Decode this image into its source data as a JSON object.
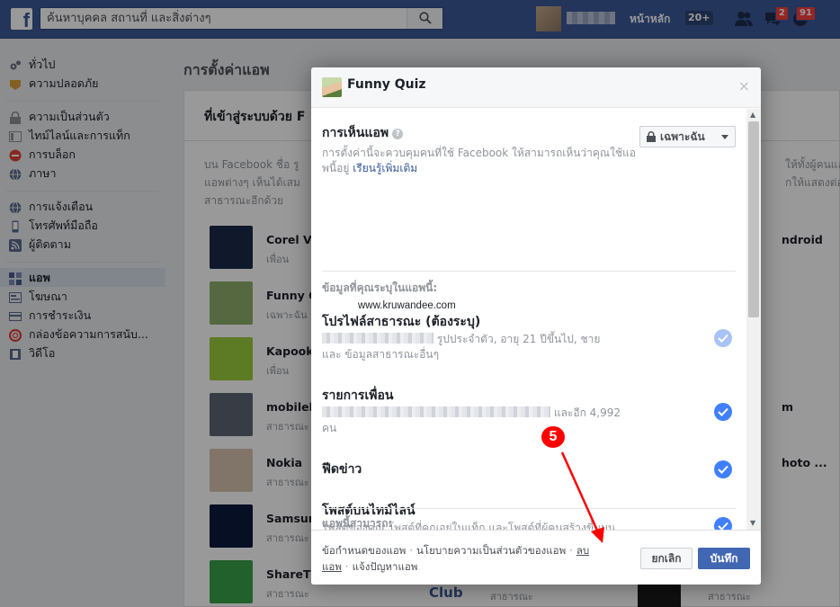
{
  "topbar": {
    "search_placeholder": "ค้นหาบุคคล สถานที่ และสิ่งต่างๆ",
    "home_label": "หน้าหลัก",
    "home_count": "20+",
    "messages_count": "2",
    "notifications_count": "91"
  },
  "leftnav": {
    "group1": [
      {
        "label": "ทั่วไป",
        "icon": "gear-icon",
        "color": "#6f7480"
      },
      {
        "label": "ความปลอดภัย",
        "icon": "badge-icon",
        "color": "#d9a13b"
      }
    ],
    "group2": [
      {
        "label": "ความเป็นส่วนตัว",
        "icon": "lock-icon",
        "color": "#8c8f95"
      },
      {
        "label": "ไทม์ไลน์และการแท็ก",
        "icon": "timeline-icon",
        "color": "#8c8f95"
      },
      {
        "label": "การบล็อก",
        "icon": "block-icon",
        "color": "#e0443a"
      },
      {
        "label": "ภาษา",
        "icon": "globe-icon",
        "color": "#5d6b8a"
      }
    ],
    "group3": [
      {
        "label": "การแจ้งเตือน",
        "icon": "globe-icon",
        "color": "#5d6b8a"
      },
      {
        "label": "โทรศัพท์มือถือ",
        "icon": "phone-icon",
        "color": "#5d6b8a"
      },
      {
        "label": "ผู้ติดตาม",
        "icon": "rss-icon",
        "color": "#5d6b8a"
      }
    ],
    "group4": [
      {
        "label": "แอพ",
        "icon": "apps-icon",
        "color": "#4a5d8c",
        "active": true
      },
      {
        "label": "โฆษณา",
        "icon": "ads-icon",
        "color": "#5d6b8a"
      },
      {
        "label": "การชำระเงิน",
        "icon": "card-icon",
        "color": "#5d6b8a"
      },
      {
        "label": "กล่องข้อความการสนับ...",
        "icon": "lifebuoy-icon",
        "color": "#e0443a"
      },
      {
        "label": "วิดีโอ",
        "icon": "film-icon",
        "color": "#5d6b8a"
      }
    ]
  },
  "main": {
    "title": "การตั้งค่าแอพ",
    "panel_heading": "ที่เข้าสู่ระบบด้วย F",
    "desc_line1": "บน Facebook ชื่อ รู",
    "desc_line2": "แอพต่างๆ เห็นได้เสม",
    "desc_line3": "สาธารณะอีกด้วย",
    "desc_right1": "ให้ทั้งผู้คนและ",
    "desc_right2": "กให้แสดงต่อ",
    "apps": [
      {
        "name": "Corel Vi",
        "privacy": "เพื่อน",
        "color": "#1b2a48",
        "right": "ndroid"
      },
      {
        "name": "Funny Q",
        "privacy": "เฉพาะฉัน",
        "color": "#8fae6a",
        "right": ""
      },
      {
        "name": "Kapook",
        "privacy": "เพื่อน",
        "color": "#9ccc3c",
        "right": ""
      },
      {
        "name": "mobileb",
        "privacy": "สาธารณะ",
        "color": "#5c6473",
        "right": "m"
      },
      {
        "name": "Nokia",
        "privacy": "สาธารณะ",
        "color": "#d8c4b0",
        "right": "hoto ..."
      },
      {
        "name": "Samsun",
        "privacy": "สาธารณะ",
        "color": "#0b1a3d",
        "right": ""
      },
      {
        "name": "ShareTh",
        "privacy": "สาธารณะ",
        "color": "#3aa14a",
        "right": ""
      }
    ],
    "bottom_club": "Club",
    "bottom_privacy2": "สาธารณะ",
    "bottom_privacy3": "สาธารณะ"
  },
  "dialog": {
    "title": "Funny Quiz",
    "visibility_title": "การเห็นแอพ",
    "visibility_help": "?",
    "visibility_desc": "การตั้งค่านี้จะควบคุมคนที่ใช้ Facebook ให้สามารถเห็นว่าคุณใช้แอพนี้อยู่",
    "learn_more": "เรียนรู้เพิ่มเติม",
    "privacy_value": "เฉพาะฉัน",
    "info_label": "ข้อมูลที่คุณระบุในแอพนี้:",
    "profile_title": "โปรไฟล์สาธารณะ (ต้องระบุ)",
    "profile_desc_a": "รูปประจำตัว, อายุ 21 ปีขึ้นไป, ชาย",
    "profile_desc_b": "และ ข้อมูลสาธารณะอื่นๆ",
    "watermark": "www.kruwandee.com",
    "friends_title": "รายการเพื่อน",
    "friends_desc_a": "และอีก 4,992",
    "friends_desc_b": "คน",
    "newsfeed_title": "ฟีดข่าว",
    "timeline_title": "โพสต์บนไทม์ไลน์",
    "timeline_desc": "โพสต์ของคุณ โพสต์ที่คุณอยู่ในแท็ก และโพสต์ที่ผู้คนสร้างขึ้นบนไทม์ไลน์ของคุณ",
    "can_label": "แอพนี้สามารถ:",
    "footer": {
      "terms": "ข้อกำหนดของแอพ",
      "policy": "นโยบายความเป็นส่วนตัวของแอพ",
      "remove_a": "ลบ",
      "remove_b": "แอพ",
      "report": "แจ้งปัญหาแอพ",
      "dot": "·"
    },
    "cancel_label": "ยกเลิก",
    "save_label": "บันทึก",
    "close_glyph": "×"
  },
  "annotation": {
    "number": "5",
    "color": "#ff0000"
  },
  "colors": {
    "brand": "#3b5998",
    "primary_button": "#4267b2",
    "check": "#4080ff"
  }
}
